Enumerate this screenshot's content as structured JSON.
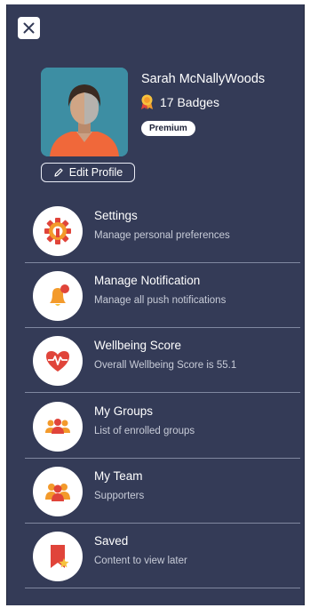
{
  "close": {
    "icon": "close-icon"
  },
  "profile": {
    "name": "Sarah McNallyWoods",
    "badges": "17 Badges",
    "badge_icon": "medal-icon",
    "tier": "Premium",
    "edit_label": "Edit Profile",
    "edit_icon": "pencil-icon",
    "avatar": "avatar"
  },
  "menu": [
    {
      "title": "Settings",
      "subtitle": "Manage personal preferences",
      "icon": "gear-icon"
    },
    {
      "title": "Manage Notification",
      "subtitle": "Manage all push notifications",
      "icon": "bell-icon"
    },
    {
      "title": "Wellbeing Score",
      "subtitle": "Overall Wellbeing Score is 55.1",
      "icon": "heart-pulse-icon"
    },
    {
      "title": "My Groups",
      "subtitle": "List of enrolled groups",
      "icon": "group-icon"
    },
    {
      "title": "My Team",
      "subtitle": "Supporters",
      "icon": "team-icon"
    },
    {
      "title": "Saved",
      "subtitle": "Content to view later",
      "icon": "bookmark-icon"
    }
  ],
  "colors": {
    "drawer_bg": "#343b57",
    "accent_red": "#e0443a",
    "accent_orange": "#f39a2b",
    "accent_yellow": "#f6c23e",
    "photo_bg": "#3d8ea3"
  }
}
